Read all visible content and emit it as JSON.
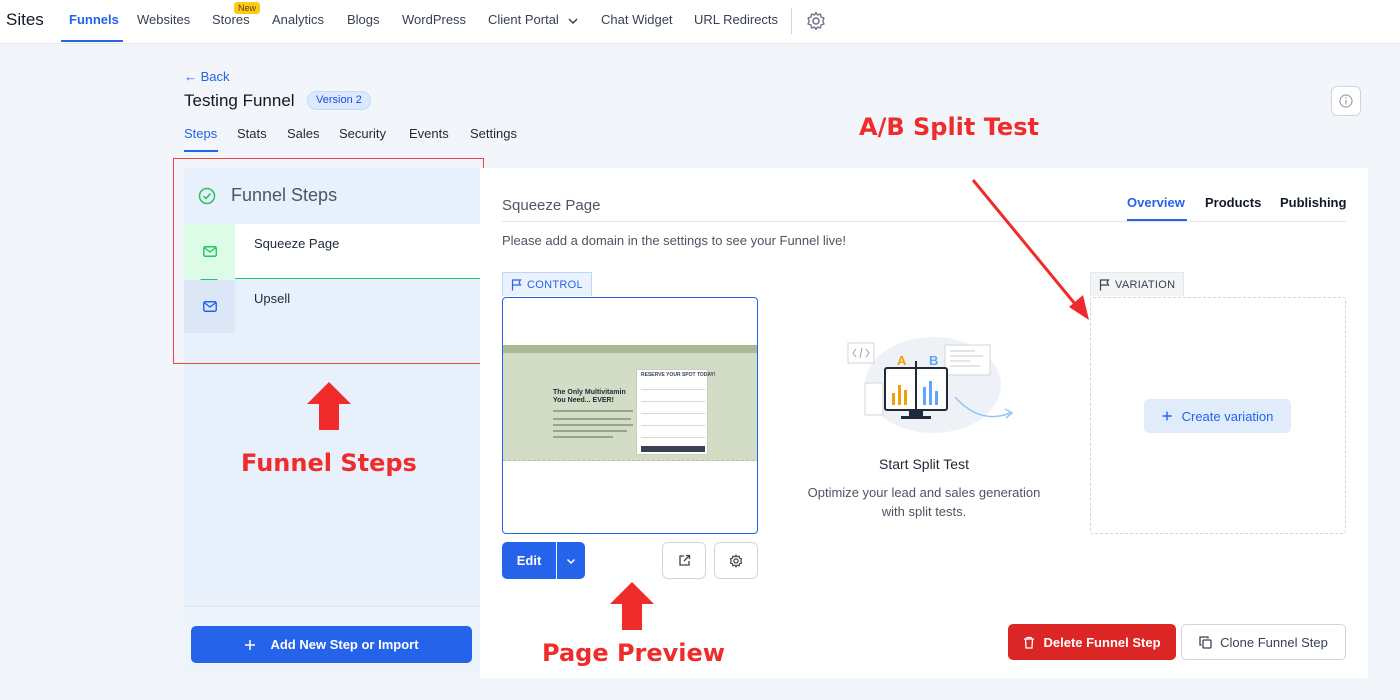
{
  "nav": {
    "brand": "Sites",
    "items": [
      "Funnels",
      "Websites",
      "Stores",
      "Analytics",
      "Blogs",
      "WordPress",
      "Client Portal",
      "Chat Widget",
      "URL Redirects"
    ],
    "new_badge": "New"
  },
  "header": {
    "back": "← Back",
    "title": "Testing Funnel",
    "version": "Version 2",
    "tabs": [
      "Steps",
      "Stats",
      "Sales",
      "Security",
      "Events",
      "Settings"
    ]
  },
  "funnel_steps": {
    "heading": "Funnel Steps",
    "steps": [
      "Squeeze Page",
      "Upsell"
    ],
    "add_button": "Add New Step or Import"
  },
  "step_panel": {
    "title": "Squeeze Page",
    "tabs": [
      "Overview",
      "Products",
      "Publishing"
    ],
    "notice": "Please add a domain in the settings to see your Funnel live!",
    "control_label": "CONTROL",
    "variation_label": "VARIATION",
    "edit_label": "Edit",
    "create_variation": "Create variation",
    "split_title": "Start Split Test",
    "split_desc": "Optimize your lead and sales generation with split tests.",
    "delete_label": "Delete Funnel Step",
    "clone_label": "Clone Funnel Step",
    "preview": {
      "headline": "The Only Multivitamin You Need... EVER!",
      "form_title": "RESERVE YOUR SPOT TODAY!"
    }
  },
  "annotations": {
    "ab_split": "A/B Split Test",
    "funnel_steps": "Funnel Steps",
    "page_preview": "Page Preview"
  },
  "colors": {
    "primary": "#2563eb",
    "danger": "#dc2626",
    "success": "#22c55e",
    "annotation": "#ef2b2b"
  }
}
